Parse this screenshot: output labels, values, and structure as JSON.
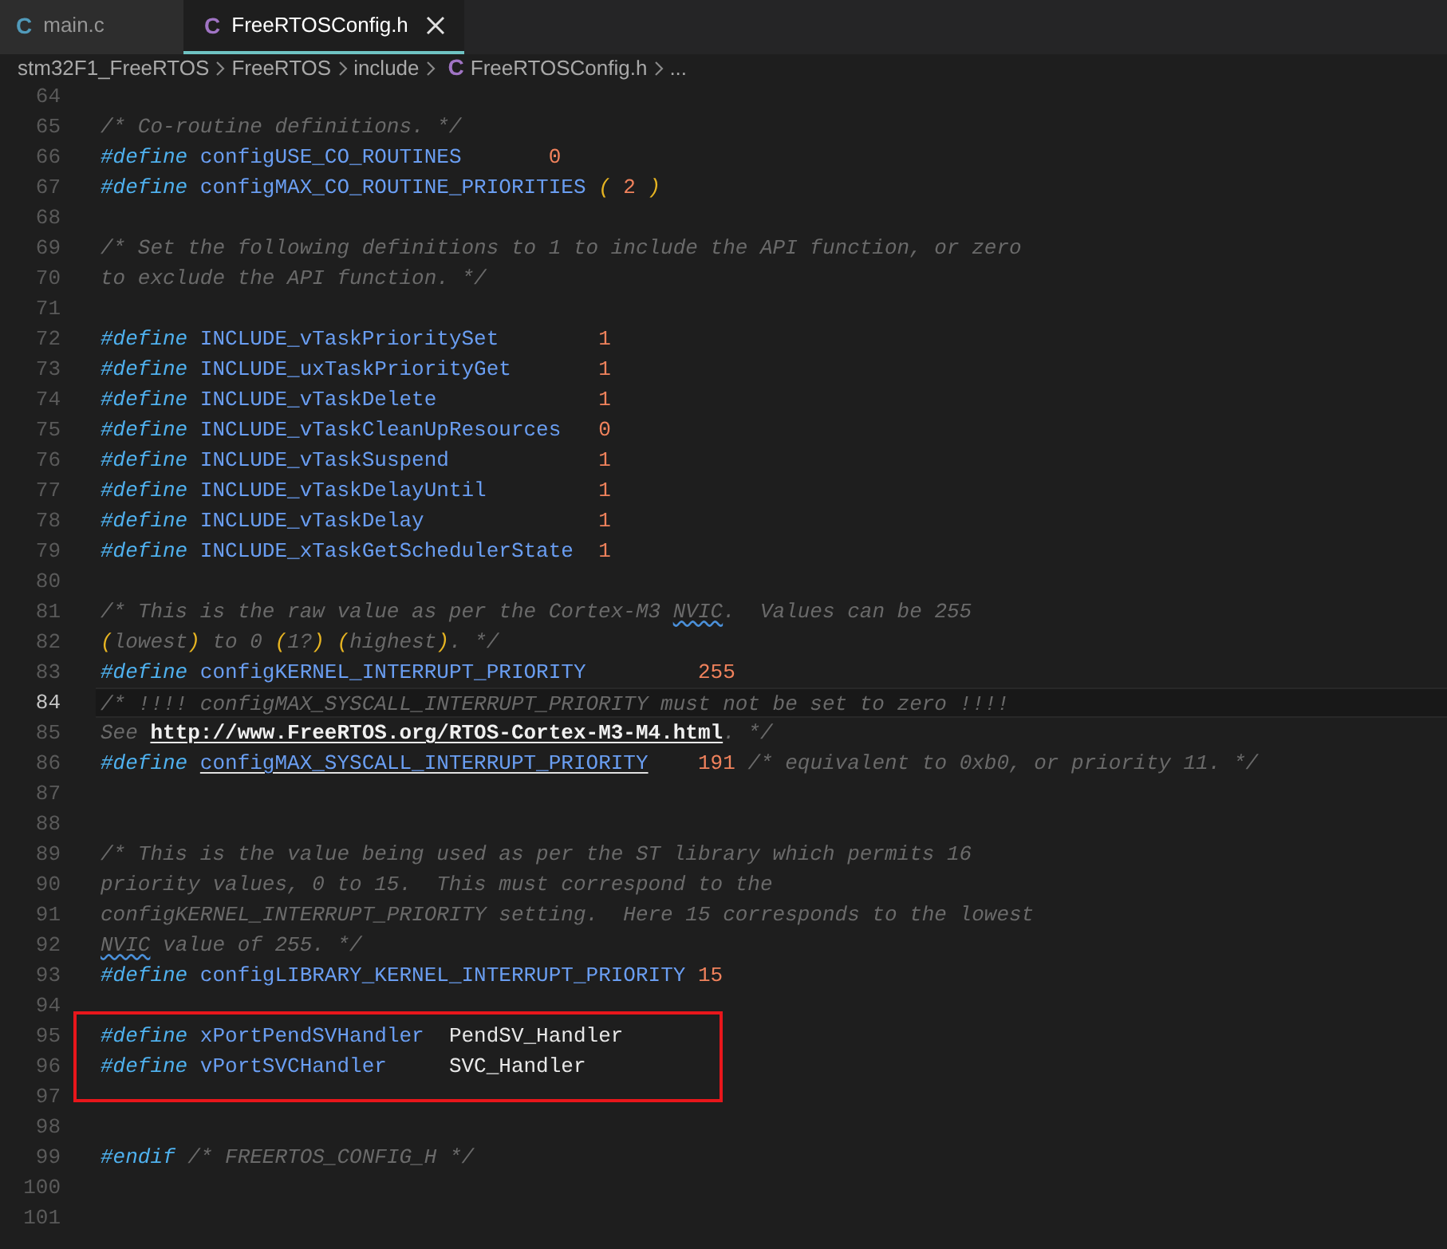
{
  "tabs": [
    {
      "icon": "C",
      "color": "#519aba",
      "label": "main.c",
      "selected": false,
      "closable": false
    },
    {
      "icon": "C",
      "color": "#a074c4",
      "label": "FreeRTOSConfig.h",
      "selected": true,
      "closable": true
    }
  ],
  "breadcrumb": [
    {
      "label": "stm32F1_FreeRTOS"
    },
    {
      "label": "FreeRTOS"
    },
    {
      "label": "include"
    },
    {
      "icon": "C",
      "color": "#a074c4",
      "label": "FreeRTOSConfig.h"
    },
    {
      "label": "..."
    }
  ],
  "editor": {
    "lines": [
      {
        "number": "64",
        "current": false,
        "boxed": false
      },
      {
        "number": "65",
        "current": false,
        "boxed": false,
        "tokens": [
          {
            "kind": "comment",
            "text": "/* Co-routine definitions. */"
          }
        ]
      },
      {
        "number": "66",
        "current": false,
        "boxed": false,
        "tokens": [
          {
            "kind": "keyword",
            "text": "#define "
          },
          {
            "kind": "macro",
            "text": "configUSE_CO_ROUTINES       "
          },
          {
            "kind": "number",
            "text": "0"
          }
        ]
      },
      {
        "number": "67",
        "current": false,
        "boxed": false,
        "tokens": [
          {
            "kind": "keyword",
            "text": "#define "
          },
          {
            "kind": "macro",
            "text": "configMAX_CO_ROUTINE_PRIORITIES "
          },
          {
            "kind": "paren",
            "text": "( "
          },
          {
            "kind": "number",
            "text": "2 "
          },
          {
            "kind": "paren",
            "text": ")"
          }
        ]
      },
      {
        "number": "68",
        "current": false,
        "boxed": false
      },
      {
        "number": "69",
        "current": false,
        "boxed": false,
        "tokens": [
          {
            "kind": "comment",
            "text": "/* Set the following definitions to 1 to include the API function, or zero"
          }
        ]
      },
      {
        "number": "70",
        "current": false,
        "boxed": false,
        "tokens": [
          {
            "kind": "comment",
            "text": "to exclude the API function. */"
          }
        ]
      },
      {
        "number": "71",
        "current": false,
        "boxed": false
      },
      {
        "number": "72",
        "current": false,
        "boxed": false,
        "tokens": [
          {
            "kind": "keyword",
            "text": "#define "
          },
          {
            "kind": "macro",
            "text": "INCLUDE_vTaskPrioritySet        "
          },
          {
            "kind": "number",
            "text": "1"
          }
        ]
      },
      {
        "number": "73",
        "current": false,
        "boxed": false,
        "tokens": [
          {
            "kind": "keyword",
            "text": "#define "
          },
          {
            "kind": "macro",
            "text": "INCLUDE_uxTaskPriorityGet       "
          },
          {
            "kind": "number",
            "text": "1"
          }
        ]
      },
      {
        "number": "74",
        "current": false,
        "boxed": false,
        "tokens": [
          {
            "kind": "keyword",
            "text": "#define "
          },
          {
            "kind": "macro",
            "text": "INCLUDE_vTaskDelete             "
          },
          {
            "kind": "number",
            "text": "1"
          }
        ]
      },
      {
        "number": "75",
        "current": false,
        "boxed": false,
        "tokens": [
          {
            "kind": "keyword",
            "text": "#define "
          },
          {
            "kind": "macro",
            "text": "INCLUDE_vTaskCleanUpResources   "
          },
          {
            "kind": "number",
            "text": "0"
          }
        ]
      },
      {
        "number": "76",
        "current": false,
        "boxed": false,
        "tokens": [
          {
            "kind": "keyword",
            "text": "#define "
          },
          {
            "kind": "macro",
            "text": "INCLUDE_vTaskSuspend            "
          },
          {
            "kind": "number",
            "text": "1"
          }
        ]
      },
      {
        "number": "77",
        "current": false,
        "boxed": false,
        "tokens": [
          {
            "kind": "keyword",
            "text": "#define "
          },
          {
            "kind": "macro",
            "text": "INCLUDE_vTaskDelayUntil         "
          },
          {
            "kind": "number",
            "text": "1"
          }
        ]
      },
      {
        "number": "78",
        "current": false,
        "boxed": false,
        "tokens": [
          {
            "kind": "keyword",
            "text": "#define "
          },
          {
            "kind": "macro",
            "text": "INCLUDE_vTaskDelay              "
          },
          {
            "kind": "number",
            "text": "1"
          }
        ]
      },
      {
        "number": "79",
        "current": false,
        "boxed": false,
        "tokens": [
          {
            "kind": "keyword",
            "text": "#define "
          },
          {
            "kind": "macro",
            "text": "INCLUDE_xTaskGetSchedulerState  "
          },
          {
            "kind": "number",
            "text": "1"
          }
        ]
      },
      {
        "number": "80",
        "current": false,
        "boxed": false
      },
      {
        "number": "81",
        "current": false,
        "boxed": false,
        "tokens": [
          {
            "kind": "comment",
            "text": "/* This is the raw value as per the Cortex-M3 "
          },
          {
            "kind": "squiggle",
            "text": "NVIC"
          },
          {
            "kind": "comment",
            "text": ".  Values can be 255"
          }
        ]
      },
      {
        "number": "82",
        "current": false,
        "boxed": false,
        "tokens": [
          {
            "kind": "paren",
            "text": "("
          },
          {
            "kind": "comment",
            "text": "lowest"
          },
          {
            "kind": "paren",
            "text": ")"
          },
          {
            "kind": "comment",
            "text": " to 0 "
          },
          {
            "kind": "paren",
            "text": "("
          },
          {
            "kind": "comment",
            "text": "1?"
          },
          {
            "kind": "paren",
            "text": ") ("
          },
          {
            "kind": "comment",
            "text": "highest"
          },
          {
            "kind": "paren",
            "text": ")"
          },
          {
            "kind": "comment",
            "text": ". */"
          }
        ]
      },
      {
        "number": "83",
        "current": false,
        "boxed": false,
        "tokens": [
          {
            "kind": "keyword",
            "text": "#define "
          },
          {
            "kind": "macro",
            "text": "configKERNEL_INTERRUPT_PRIORITY         "
          },
          {
            "kind": "number",
            "text": "255"
          }
        ]
      },
      {
        "number": "84",
        "current": true,
        "boxed": false,
        "tokens": [
          {
            "kind": "comment",
            "text": "/* !!!! configMAX_SYSCALL_INTERRUPT_PRIORITY must not be set to zero !!!!"
          }
        ]
      },
      {
        "number": "85",
        "current": false,
        "boxed": false,
        "tokens": [
          {
            "kind": "comment",
            "text": "See "
          },
          {
            "kind": "link",
            "text": "http://www.FreeRTOS.org/RTOS-Cortex-M3-M4.html"
          },
          {
            "kind": "comment",
            "text": ". */"
          }
        ]
      },
      {
        "number": "86",
        "current": false,
        "boxed": false,
        "tokens": [
          {
            "kind": "keyword",
            "text": "#define "
          },
          {
            "kind": "macro_link",
            "text": "configMAX_SYSCALL_INTERRUPT_PRIORITY"
          },
          {
            "kind": "number",
            "text": "    191"
          },
          {
            "kind": "comment",
            "text": " /* equivalent to 0xb0, or priority 11. */"
          }
        ]
      },
      {
        "number": "87",
        "current": false,
        "boxed": false
      },
      {
        "number": "88",
        "current": false,
        "boxed": false
      },
      {
        "number": "89",
        "current": false,
        "boxed": false,
        "tokens": [
          {
            "kind": "comment",
            "text": "/* This is the value being used as per the ST library which permits 16"
          }
        ]
      },
      {
        "number": "90",
        "current": false,
        "boxed": false,
        "tokens": [
          {
            "kind": "comment",
            "text": "priority values, 0 to 15.  This must correspond to the"
          }
        ]
      },
      {
        "number": "91",
        "current": false,
        "boxed": false,
        "tokens": [
          {
            "kind": "comment",
            "text": "configKERNEL_INTERRUPT_PRIORITY setting.  Here 15 corresponds to the lowest"
          }
        ]
      },
      {
        "number": "92",
        "current": false,
        "boxed": false,
        "tokens": [
          {
            "kind": "squiggle",
            "text": "NVIC"
          },
          {
            "kind": "comment",
            "text": " value of 255. */"
          }
        ]
      },
      {
        "number": "93",
        "current": false,
        "boxed": false,
        "tokens": [
          {
            "kind": "keyword",
            "text": "#define "
          },
          {
            "kind": "macro",
            "text": "configLIBRARY_KERNEL_INTERRUPT_PRIORITY "
          },
          {
            "kind": "number",
            "text": "15"
          }
        ]
      },
      {
        "number": "94",
        "current": false,
        "boxed": false
      },
      {
        "number": "95",
        "current": false,
        "boxed": true,
        "tokens": [
          {
            "kind": "keyword",
            "text": "#define "
          },
          {
            "kind": "macro",
            "text": "xPortPendSVHandler  "
          },
          {
            "kind": "plain",
            "text": "PendSV_Handler"
          }
        ]
      },
      {
        "number": "96",
        "current": false,
        "boxed": true,
        "tokens": [
          {
            "kind": "keyword",
            "text": "#define "
          },
          {
            "kind": "macro",
            "text": "vPortSVCHandler     "
          },
          {
            "kind": "plain",
            "text": "SVC_Handler"
          }
        ]
      },
      {
        "number": "97",
        "current": false,
        "boxed": true
      },
      {
        "number": "98",
        "current": false,
        "boxed": false
      },
      {
        "number": "99",
        "current": false,
        "boxed": false,
        "tokens": [
          {
            "kind": "keyword",
            "text": "#endif"
          },
          {
            "kind": "comment",
            "text": " /* FREERTOS_CONFIG_H */"
          }
        ]
      },
      {
        "number": "100",
        "current": false,
        "boxed": false
      },
      {
        "number": "101",
        "current": false,
        "boxed": false
      }
    ]
  }
}
